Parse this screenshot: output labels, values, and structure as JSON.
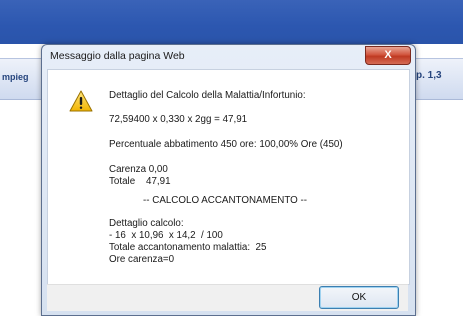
{
  "background": {
    "left_label": "mpieg",
    "right_label": "p. 1,3"
  },
  "dialog": {
    "title": "Messaggio dalla pagina Web",
    "close_glyph": "X",
    "icon": "warning-icon",
    "lines": [
      "Dettaglio del Calcolo della Malattia/Infortunio:",
      "72,59400 x 0,330 x 2gg = 47,91",
      "Percentuale abbatimento 450 ore: 100,00% Ore (450)",
      "Carenza 0,00",
      "Totale    47,91",
      "-- CALCOLO ACCANTONAMENTO --",
      "Dettaglio calcolo:",
      "- 16  x 10,96  x 14,2  / 100",
      "Totale accantonamento malattia:  25",
      "Ore carenza=0"
    ],
    "ok_label": "OK"
  },
  "colors": {
    "topbar": "#2c57b0",
    "dialog_frame": "#d6e1f0",
    "close_button": "#c9452c",
    "ok_border": "#3c7fb1"
  }
}
